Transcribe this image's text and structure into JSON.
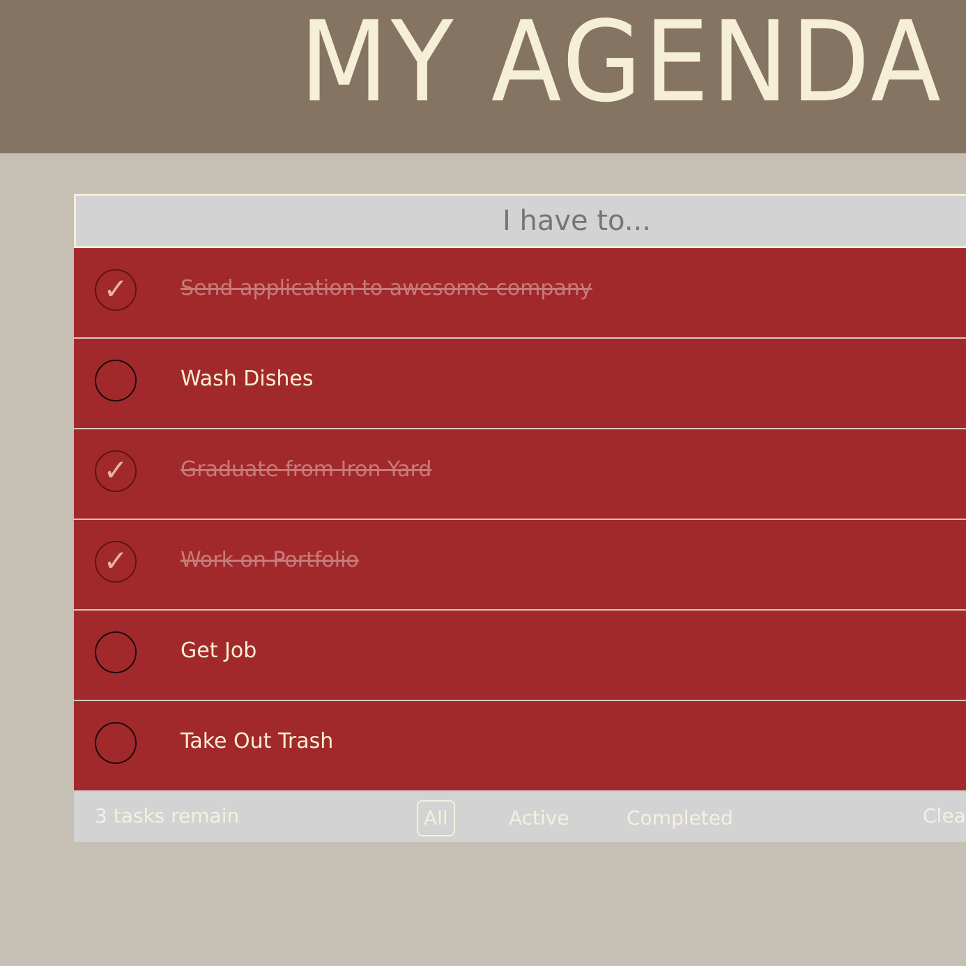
{
  "header": {
    "title_main": "MY",
    "title_second": "AGENDA"
  },
  "new_todo": {
    "placeholder": "I have to..."
  },
  "todos": [
    {
      "text": "Send application to awesome company",
      "completed": true
    },
    {
      "text": "Wash Dishes",
      "completed": false
    },
    {
      "text": "Graduate from Iron Yard",
      "completed": true
    },
    {
      "text": "Work on Portfolio",
      "completed": true
    },
    {
      "text": "Get Job",
      "completed": false
    },
    {
      "text": "Take Out Trash",
      "completed": false
    }
  ],
  "footer": {
    "count_text": "3 tasks remain",
    "filters": [
      "All",
      "Active",
      "Completed"
    ],
    "selected_filter": "All",
    "clear_label": "Clear"
  },
  "icons": {
    "checkmark": "✓"
  },
  "colors": {
    "header_bg": "#857461",
    "page_bg": "#c6bfb4",
    "item_bg": "#a2292b",
    "footer_bg": "#d3d3d3",
    "title_text": "#f6efd8"
  }
}
